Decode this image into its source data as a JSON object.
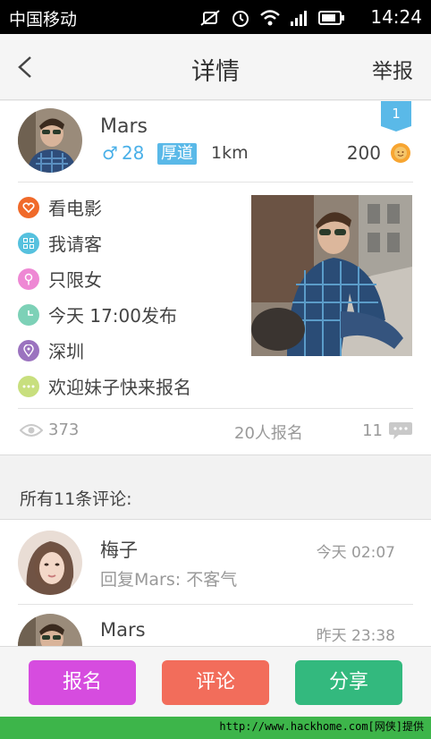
{
  "status_bar": {
    "carrier": "中国移动",
    "time": "14:24",
    "icons": [
      "mute-icon",
      "alarm-icon",
      "wifi-icon",
      "signal-icon",
      "battery-icon"
    ]
  },
  "navbar": {
    "title": "详情",
    "report_label": "举报"
  },
  "post": {
    "user_name": "Mars",
    "gender_symbol": "♂",
    "age": "28",
    "tag": "厚道",
    "distance": "1km",
    "rank": "1",
    "points": "200",
    "details": [
      {
        "icon": "heart-icon",
        "color": "#f06a2a",
        "text": "看电影"
      },
      {
        "icon": "grid-icon",
        "color": "#56c1de",
        "text": "我请客"
      },
      {
        "icon": "female-icon",
        "color": "#ee88d4",
        "text": "只限女"
      },
      {
        "icon": "clock-icon",
        "color": "#7dd1b7",
        "text": "今天 17:00发布"
      },
      {
        "icon": "location-icon",
        "color": "#9b73bf",
        "text": "深圳"
      },
      {
        "icon": "more-icon",
        "color": "#c8df7e",
        "text": "欢迎妹子快来报名"
      }
    ],
    "views": "373",
    "signups": "20人报名",
    "comment_count": "11"
  },
  "comments_section": {
    "title": "所有11条评论:",
    "items": [
      {
        "name": "梅子",
        "time": "今天  02:07",
        "text": "回复Mars: 不客气"
      },
      {
        "name": "Mars",
        "time": "昨天  23:38",
        "text": ""
      }
    ]
  },
  "actions": {
    "signup_label": "报名",
    "comment_label": "评论",
    "share_label": "分享"
  },
  "colors": {
    "signup": "#d64cdf",
    "comment": "#f26d5b",
    "share": "#33b97e",
    "accent_blue": "#4ab0e8"
  },
  "watermark": "http://www.hackhome.com[网侠]提供"
}
